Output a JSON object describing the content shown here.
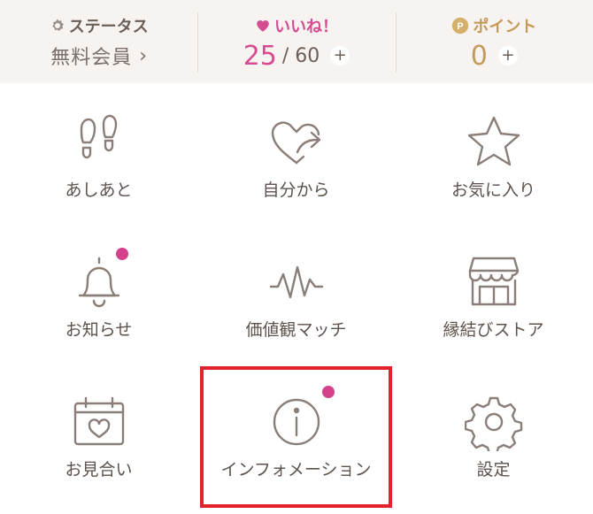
{
  "header": {
    "status": {
      "label": "ステータス",
      "value": "無料会員",
      "chevron": "›",
      "icon": "gear-icon"
    },
    "likes": {
      "label": "いいね！",
      "count": "25",
      "max": "/ 60",
      "plus": "+",
      "icon": "heart-icon",
      "color": "#d64c92"
    },
    "points": {
      "label": "ポイント",
      "count": "0",
      "plus": "+",
      "icon": "point-coin-icon",
      "color": "#c39a59"
    }
  },
  "menu": {
    "items": [
      {
        "label": "あしあと",
        "icon": "footprints-icon",
        "badge": false
      },
      {
        "label": "自分から",
        "icon": "heart-arrow-icon",
        "badge": false
      },
      {
        "label": "お気に入り",
        "icon": "star-icon",
        "badge": false
      },
      {
        "label": "お知らせ",
        "icon": "bell-icon",
        "badge": true
      },
      {
        "label": "価値観マッチ",
        "icon": "pulse-icon",
        "badge": false
      },
      {
        "label": "縁結びストア",
        "icon": "store-icon",
        "badge": false
      },
      {
        "label": "お見合い",
        "icon": "calendar-heart-icon",
        "badge": false
      },
      {
        "label": "インフォメーション",
        "icon": "info-icon",
        "badge": true
      },
      {
        "label": "設定",
        "icon": "gear-icon",
        "badge": false
      }
    ]
  },
  "colors": {
    "badge": "#d6418e",
    "highlight": "#e3222d",
    "icon_stroke": "#8a7e78"
  }
}
